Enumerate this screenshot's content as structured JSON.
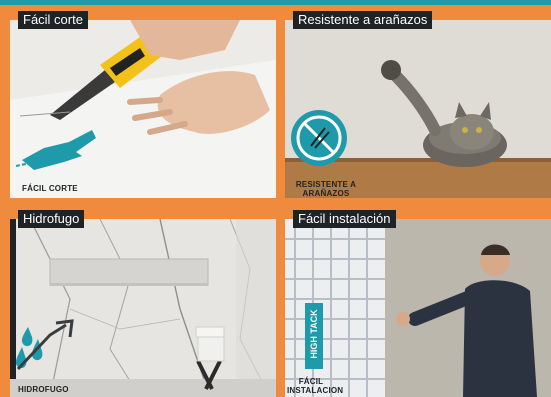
{
  "panels": [
    {
      "title": "Fácil corte",
      "caption": "FÁCIL CORTE",
      "icon": "cutting-hand-icon"
    },
    {
      "title": "Resistente a arañazos",
      "caption_lines": [
        "RESISTENTE A",
        "ARAÑAZOS"
      ],
      "icon": "no-scratch-icon"
    },
    {
      "title": "Hidrofugo",
      "caption": "HIDROFUGO",
      "icon": "water-drops-icon"
    },
    {
      "title": "Fácil instalación",
      "caption_lines": [
        "FÁCIL",
        "INSTALACION"
      ],
      "product_label": "HIGH TACK"
    }
  ],
  "colors": {
    "background": "#f08a3c",
    "accent": "#1e9aaa",
    "title_bg": "#1f2326",
    "title_text": "#ffffff"
  }
}
